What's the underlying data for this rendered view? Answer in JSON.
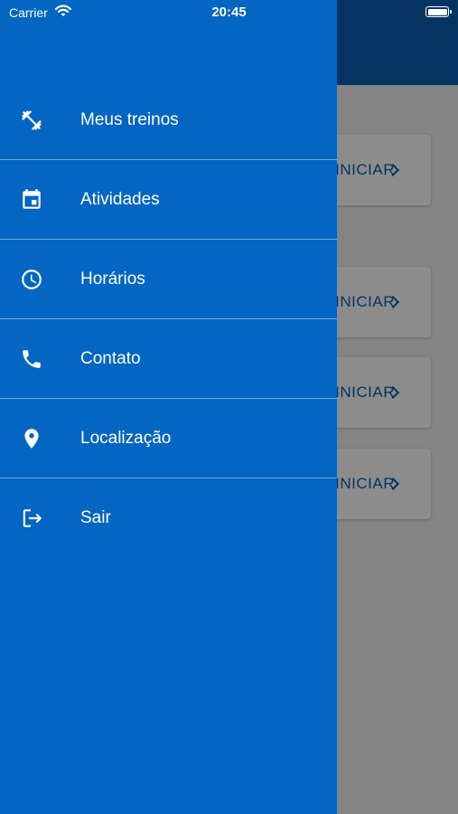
{
  "status_bar": {
    "carrier": "Carrier",
    "time": "20:45"
  },
  "drawer": {
    "background_color": "#0266c2",
    "items": [
      {
        "label": "Meus treinos",
        "icon": "dumbbell-icon"
      },
      {
        "label": "Atividades",
        "icon": "calendar-icon"
      },
      {
        "label": "Horários",
        "icon": "clock-icon"
      },
      {
        "label": "Contato",
        "icon": "phone-icon"
      },
      {
        "label": "Localização",
        "icon": "location-pin-icon"
      },
      {
        "label": "Sair",
        "icon": "logout-icon"
      }
    ]
  },
  "background_screen": {
    "header_color": "#0b5fb3",
    "cards": [
      {
        "action_label": "INICIAR"
      },
      {
        "action_label": "INICIAR"
      },
      {
        "action_label": "INICIAR"
      },
      {
        "action_label": "INICIAR"
      }
    ]
  }
}
